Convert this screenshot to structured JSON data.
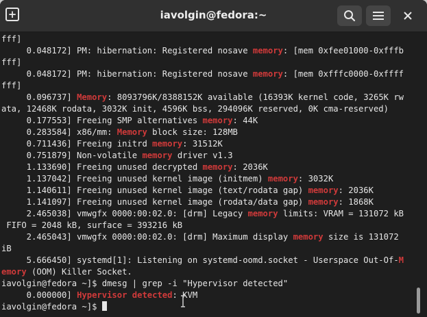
{
  "window": {
    "title": "iavolgin@fedora:~",
    "icons": {
      "new_tab": "new-tab-icon",
      "search": "search-icon",
      "menu": "hamburger-menu-icon",
      "close": "close-icon"
    }
  },
  "terminal": {
    "highlight_color": "#d03a3a",
    "lines": [
      [
        {
          "t": "fff]"
        }
      ],
      [
        {
          "t": "     0.048172] PM: hibernation: Registered nosave "
        },
        {
          "t": "memory",
          "h": true
        },
        {
          "t": ": [mem 0xfee01000-0xfffb"
        }
      ],
      [
        {
          "t": "fff]"
        }
      ],
      [
        {
          "t": "     0.048172] PM: hibernation: Registered nosave "
        },
        {
          "t": "memory",
          "h": true
        },
        {
          "t": ": [mem 0xfffc0000-0xffff"
        }
      ],
      [
        {
          "t": "fff]"
        }
      ],
      [
        {
          "t": "     0.096737] "
        },
        {
          "t": "Memory",
          "h": true
        },
        {
          "t": ": 8093796K/8388152K available (16393K kernel code, 3265K rw"
        }
      ],
      [
        {
          "t": "ata, 12468K rodata, 3032K init, 4596K bss, 294096K reserved, 0K cma-reserved)"
        }
      ],
      [
        {
          "t": "     0.177553] Freeing SMP alternatives "
        },
        {
          "t": "memory",
          "h": true
        },
        {
          "t": ": 44K"
        }
      ],
      [
        {
          "t": "     0.283584] x86/mm: "
        },
        {
          "t": "Memory",
          "h": true
        },
        {
          "t": " block size: 128MB"
        }
      ],
      [
        {
          "t": "     0.711436] Freeing initrd "
        },
        {
          "t": "memory",
          "h": true
        },
        {
          "t": ": 31512K"
        }
      ],
      [
        {
          "t": "     0.751879] Non-volatile "
        },
        {
          "t": "memory",
          "h": true
        },
        {
          "t": " driver v1.3"
        }
      ],
      [
        {
          "t": "     1.133690] Freeing unused decrypted "
        },
        {
          "t": "memory",
          "h": true
        },
        {
          "t": ": 2036K"
        }
      ],
      [
        {
          "t": "     1.137042] Freeing unused kernel image (initmem) "
        },
        {
          "t": "memory",
          "h": true
        },
        {
          "t": ": 3032K"
        }
      ],
      [
        {
          "t": "     1.140611] Freeing unused kernel image (text/rodata gap) "
        },
        {
          "t": "memory",
          "h": true
        },
        {
          "t": ": 2036K"
        }
      ],
      [
        {
          "t": "     1.141097] Freeing unused kernel image (rodata/data gap) "
        },
        {
          "t": "memory",
          "h": true
        },
        {
          "t": ": 1868K"
        }
      ],
      [
        {
          "t": "     2.465038] vmwgfx 0000:00:02.0: [drm] Legacy "
        },
        {
          "t": "memory",
          "h": true
        },
        {
          "t": " limits: VRAM = 131072 kB"
        }
      ],
      [
        {
          "t": " FIFO = 2048 kB, surface = 393216 kB"
        }
      ],
      [
        {
          "t": "     2.465043] vmwgfx 0000:00:02.0: [drm] Maximum display "
        },
        {
          "t": "memory",
          "h": true
        },
        {
          "t": " size is 131072"
        }
      ],
      [
        {
          "t": "iB"
        }
      ],
      [
        {
          "t": "     5.666450] systemd[1]: Listening on systemd-oomd.socket - Userspace Out-Of-"
        },
        {
          "t": "M",
          "h": true
        }
      ],
      [
        {
          "t": "emory",
          "h": true
        },
        {
          "t": " (OOM) Killer Socket."
        }
      ],
      [
        {
          "t": "iavolgin@fedora ~]$ dmesg | grep -i \"Hypervisor detected\""
        }
      ],
      [
        {
          "t": "     0.000000] "
        },
        {
          "t": "Hypervisor detected",
          "h": true
        },
        {
          "t": ": KVM"
        }
      ],
      [
        {
          "t": "iavolgin@fedora ~]$ "
        }
      ]
    ]
  }
}
